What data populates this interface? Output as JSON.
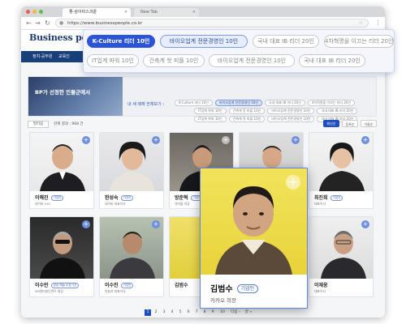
{
  "browser": {
    "tab_active": "좋-삼아비스과끝",
    "tab_inactive": "New Tab",
    "url": "https://www.businesspeople.co.kr",
    "back_icon": "arrow-left-icon",
    "forward_icon": "arrow-right-icon",
    "reload_icon": "reload-icon"
  },
  "site": {
    "logo": "Business people",
    "nav": [
      "정치·공무원",
      "교육인"
    ]
  },
  "banner": {
    "title": "BP가 선정한 인물군에서",
    "link": "내 새 매체 전체보기 ›",
    "chips_row1": [
      "K-Culture 리더 10인",
      "바이오업계 전문경영인 10인",
      "국내 대표 IB 리더 20인",
      "4차혁명을 이끄는 리더 20인"
    ],
    "chips_row2": [
      "IT업계 파워 10인",
      "건축계 핫 피플 10인",
      "바이오업계 전문경영인 10인",
      "국내 대표 IB 리더 20인"
    ],
    "chips_row3": [
      "IT업계 파워 10인",
      "건축계 핫 피플 10인",
      "바이오업계 전문경영인 10인",
      "국내 대표 IB 리더 20인"
    ]
  },
  "filter": {
    "button": "필터링",
    "count_text": "관계 결과 : 968 건",
    "sort": [
      "최신순",
      "등록순",
      "이름순"
    ]
  },
  "overlay_tags": {
    "row1": [
      "K-Culture 리더 10인",
      "바이오업계 전문경영인 10인",
      "국내 대표 IB 리더 20인",
      "4차혁명을 이끄는 리더 20인"
    ],
    "row2": [
      "IT업계 파워 10인",
      "건축계 핫 피플 10인",
      "바이오업계 전문경영인 10인",
      "국내 대표 IB 리더 20인"
    ]
  },
  "cards": [
    {
      "name": "이해진",
      "badge": "기업인",
      "desc": "네이버 GIO"
    },
    {
      "name": "한성숙",
      "badge": "기업인",
      "desc": "네이버 대표이사"
    },
    {
      "name": "방준혁",
      "badge": "기업인",
      "desc": "넷마블 의장"
    },
    {
      "name": "",
      "badge": "",
      "desc": ""
    },
    {
      "name": "최진희",
      "badge": "기업인",
      "desc": "대표이사"
    },
    {
      "name": "이수만",
      "badge": "방송·예술·오호기선",
      "desc": "SM엔터테인먼트 회장"
    },
    {
      "name": "이수진",
      "badge": "기업인",
      "desc": "야놀자 대표이사"
    },
    {
      "name": "김범수",
      "badge": "",
      "desc": ""
    },
    {
      "name": "",
      "badge": "",
      "desc": ""
    },
    {
      "name": "이재웅",
      "badge": "",
      "desc": "대표이사"
    }
  ],
  "zoom_card": {
    "name": "김범수",
    "badge": "기업인",
    "desc": "카카오 의장"
  },
  "pagination": {
    "pages": [
      "1",
      "2",
      "3",
      "4",
      "5",
      "6",
      "7",
      "8",
      "9",
      "10"
    ],
    "next": "다음 ›",
    "last": "끝 »",
    "current": "1"
  },
  "colors": {
    "accent": "#2b55d6",
    "nav": "#173f7a",
    "badge_border": "#7d98d6"
  }
}
